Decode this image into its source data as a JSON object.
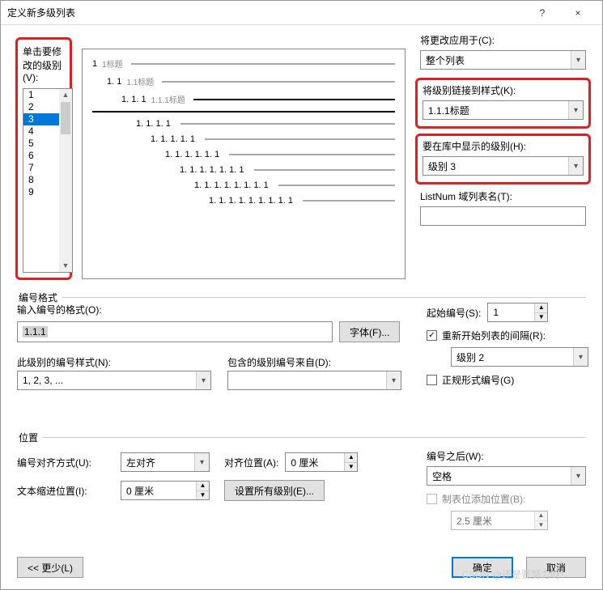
{
  "title": "定义新多级列表",
  "titlebar": {
    "help": "?",
    "close": "×"
  },
  "left": {
    "click_level_label": "单击要修改的级别(V):",
    "levels": [
      "1",
      "2",
      "3",
      "4",
      "5",
      "6",
      "7",
      "8",
      "9"
    ],
    "selected_index": 2
  },
  "preview": {
    "rows": [
      {
        "indent": 0,
        "num": "1",
        "sub": "1标题",
        "bold": false
      },
      {
        "indent": 1,
        "num": "1. 1",
        "sub": "1.1标题",
        "bold": false
      },
      {
        "indent": 2,
        "num": "1. 1. 1",
        "sub": "1.1.1标题",
        "bold": true
      },
      {
        "rule": true
      },
      {
        "indent": 3,
        "num": "1. 1. 1. 1",
        "sub": "",
        "bold": false
      },
      {
        "indent": 4,
        "num": "1. 1. 1. 1. 1",
        "sub": "",
        "bold": false
      },
      {
        "indent": 5,
        "num": "1. 1. 1. 1. 1. 1",
        "sub": "",
        "bold": false
      },
      {
        "indent": 6,
        "num": "1. 1. 1. 1. 1. 1. 1",
        "sub": "",
        "bold": false
      },
      {
        "indent": 7,
        "num": "1. 1. 1. 1. 1. 1. 1. 1",
        "sub": "",
        "bold": false
      },
      {
        "indent": 8,
        "num": "1. 1. 1. 1. 1. 1. 1. 1. 1",
        "sub": "",
        "bold": false
      }
    ]
  },
  "right": {
    "apply_label": "将更改应用于(C):",
    "apply_value": "整个列表",
    "link_label": "将级别链接到样式(K):",
    "link_value": "1.1.1标题",
    "show_label": "要在库中显示的级别(H):",
    "show_value": "级别 3",
    "listnum_label": "ListNum 域列表名(T):",
    "listnum_value": ""
  },
  "numfmt": {
    "section_title": "编号格式",
    "enter_label": "输入编号的格式(O):",
    "enter_value": "1.1.1",
    "font_btn": "字体(F)...",
    "style_label": "此级别的编号样式(N):",
    "style_value": "1, 2, 3, ...",
    "include_label": "包含的级别编号来自(D):",
    "include_value": "",
    "start_label": "起始编号(S):",
    "start_value": "1",
    "restart_label": "重新开始列表的间隔(R):",
    "restart_checked": true,
    "restart_value": "级别 2",
    "formal_label": "正规形式编号(G)",
    "formal_checked": false
  },
  "pos": {
    "section_title": "位置",
    "align_label": "编号对齐方式(U):",
    "align_value": "左对齐",
    "align_pos_label": "对齐位置(A):",
    "align_pos_value": "0 厘米",
    "indent_label": "文本缩进位置(I):",
    "indent_value": "0 厘米",
    "setall_btn": "设置所有级别(E)...",
    "after_label": "编号之后(W):",
    "after_value": "空格",
    "tab_label": "制表位添加位置(B):",
    "tab_checked": false,
    "tab_value": "2.5 厘米"
  },
  "footer": {
    "less": "<< 更少(L)",
    "ok": "确定",
    "cancel": "取消"
  },
  "watermark": "CSDN @还是要努力呀！"
}
